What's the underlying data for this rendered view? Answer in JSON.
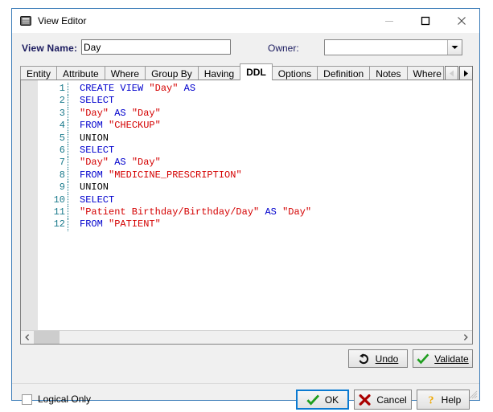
{
  "window": {
    "title": "View Editor",
    "icon": "view-editor-icon",
    "buttons": {
      "minimize": "minimize-icon",
      "maximize": "maximize-icon",
      "close": "close-icon"
    }
  },
  "fields": {
    "view_name_label": "View Name:",
    "view_name_value": "Day",
    "owner_label": "Owner:",
    "owner_value": "",
    "owner_placeholder": ""
  },
  "tabs": {
    "items": [
      {
        "label": "Entity",
        "selected": false
      },
      {
        "label": "Attribute",
        "selected": false
      },
      {
        "label": "Where",
        "selected": false
      },
      {
        "label": "Group By",
        "selected": false
      },
      {
        "label": "Having",
        "selected": false
      },
      {
        "label": "DDL",
        "selected": true
      },
      {
        "label": "Options",
        "selected": false
      },
      {
        "label": "Definition",
        "selected": false
      },
      {
        "label": "Notes",
        "selected": false
      },
      {
        "label": "Where U",
        "selected": false
      }
    ],
    "scroll_left": "scroll-left-icon",
    "scroll_right": "scroll-right-icon"
  },
  "editor": {
    "lines": [
      {
        "n": "1",
        "tokens": [
          {
            "t": "CREATE VIEW ",
            "c": "kw"
          },
          {
            "t": "\"Day\"",
            "c": "str"
          },
          {
            "t": " ",
            "c": "pl"
          },
          {
            "t": "AS",
            "c": "kw"
          }
        ]
      },
      {
        "n": "2",
        "tokens": [
          {
            "t": "SELECT",
            "c": "kw"
          }
        ]
      },
      {
        "n": "3",
        "tokens": [
          {
            "t": "\"Day\"",
            "c": "str"
          },
          {
            "t": " ",
            "c": "pl"
          },
          {
            "t": "AS",
            "c": "kw"
          },
          {
            "t": " ",
            "c": "pl"
          },
          {
            "t": "\"Day\"",
            "c": "str"
          }
        ]
      },
      {
        "n": "4",
        "tokens": [
          {
            "t": "FROM ",
            "c": "kw"
          },
          {
            "t": "\"CHECKUP\"",
            "c": "str"
          }
        ]
      },
      {
        "n": "5",
        "tokens": [
          {
            "t": "UNION",
            "c": "pl"
          }
        ]
      },
      {
        "n": "6",
        "tokens": [
          {
            "t": "SELECT",
            "c": "kw"
          }
        ]
      },
      {
        "n": "7",
        "tokens": [
          {
            "t": "\"Day\"",
            "c": "str"
          },
          {
            "t": " ",
            "c": "pl"
          },
          {
            "t": "AS",
            "c": "kw"
          },
          {
            "t": " ",
            "c": "pl"
          },
          {
            "t": "\"Day\"",
            "c": "str"
          }
        ]
      },
      {
        "n": "8",
        "tokens": [
          {
            "t": "FROM ",
            "c": "kw"
          },
          {
            "t": "\"MEDICINE_PRESCRIPTION\"",
            "c": "str"
          }
        ]
      },
      {
        "n": "9",
        "tokens": [
          {
            "t": "UNION",
            "c": "pl"
          }
        ]
      },
      {
        "n": "10",
        "tokens": [
          {
            "t": "SELECT",
            "c": "kw"
          }
        ]
      },
      {
        "n": "11",
        "tokens": [
          {
            "t": "\"Patient Birthday/Birthday/Day\"",
            "c": "str"
          },
          {
            "t": " ",
            "c": "pl"
          },
          {
            "t": "AS",
            "c": "kw"
          },
          {
            "t": " ",
            "c": "pl"
          },
          {
            "t": "\"Day\"",
            "c": "str"
          }
        ]
      },
      {
        "n": "12",
        "tokens": [
          {
            "t": "FROM ",
            "c": "kw"
          },
          {
            "t": "\"PATIENT\"",
            "c": "str"
          }
        ]
      }
    ],
    "scroll_left_icon": "scroll-left-icon",
    "scroll_right_icon": "scroll-right-icon"
  },
  "actions": {
    "undo_label": "Undo",
    "undo_icon": "undo-arrow-icon",
    "validate_label": "Validate",
    "validate_icon": "green-check-icon"
  },
  "footer": {
    "logical_only_label": "Logical Only",
    "logical_only_checked": false,
    "ok_label": "OK",
    "ok_icon": "green-check-icon",
    "cancel_label": "Cancel",
    "cancel_icon": "red-x-icon",
    "help_label": "Help",
    "help_icon": "question-mark-icon"
  },
  "colors": {
    "accent_focus": "#0b7ad1",
    "window_border": "#3b7cb8",
    "keyword": "#0000cd",
    "string": "#d40000",
    "line_number": "#1a7a8c",
    "label": "#1a1a5e"
  }
}
